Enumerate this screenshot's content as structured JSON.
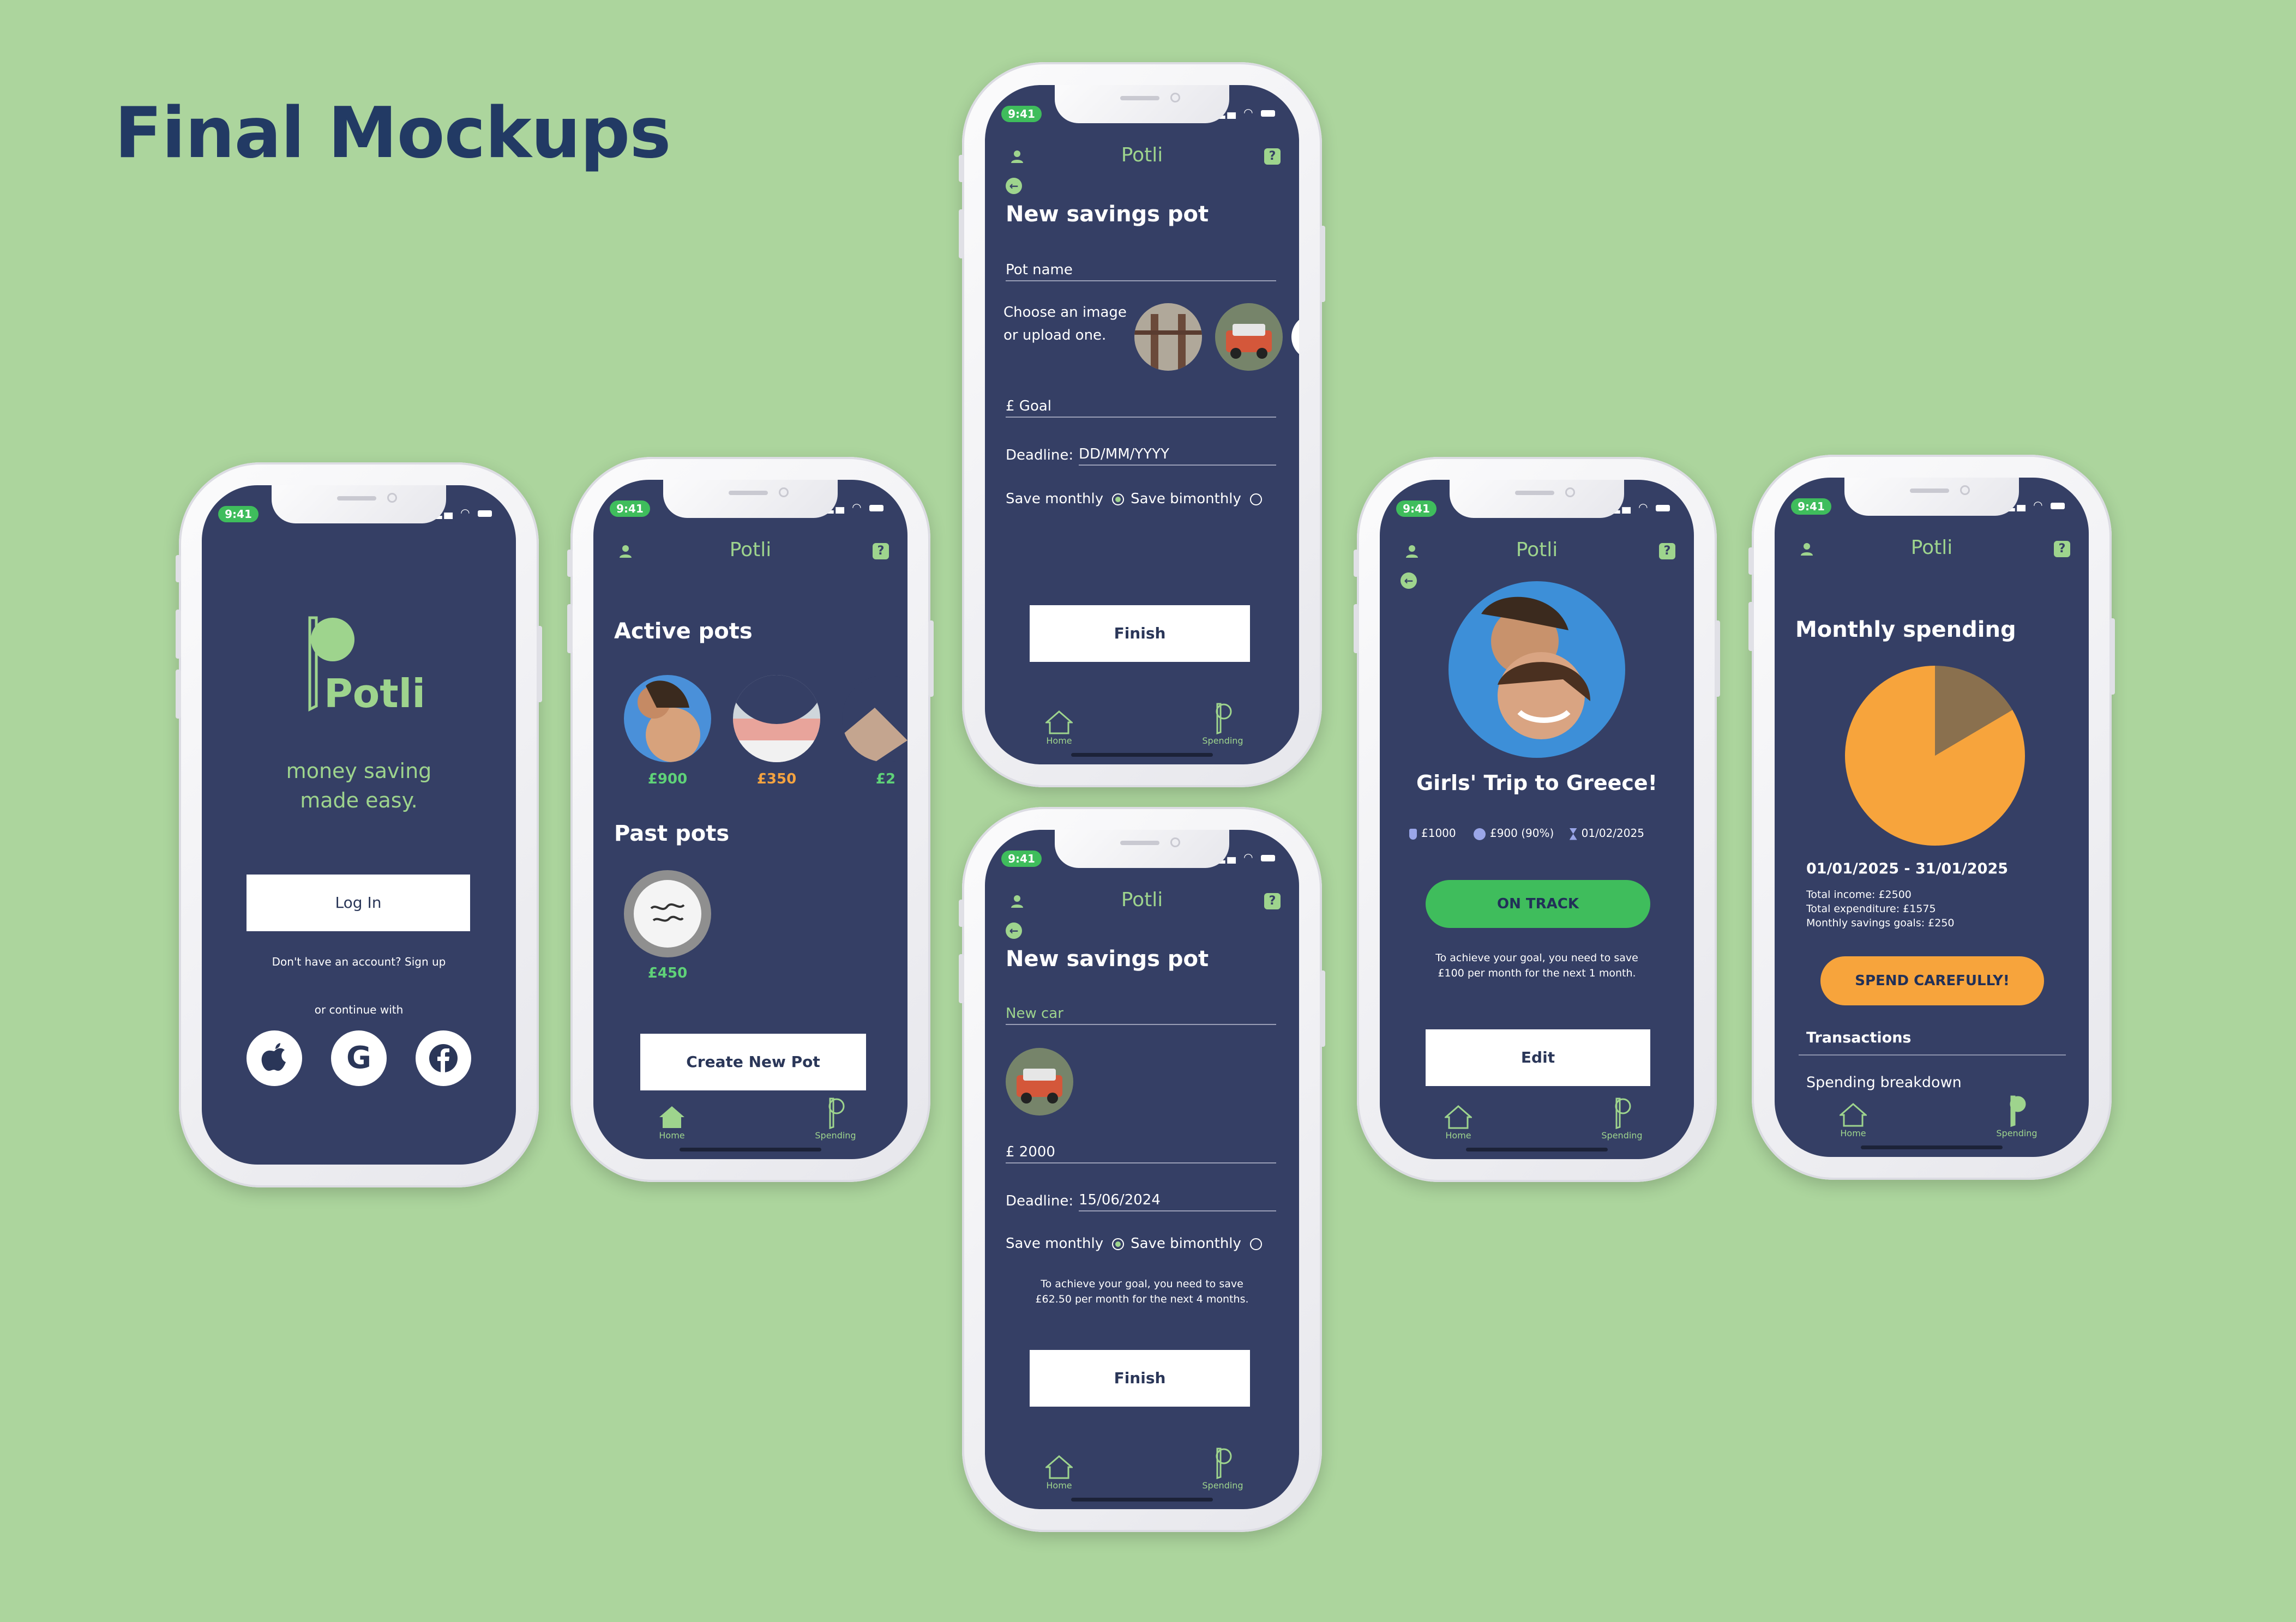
{
  "page": {
    "heading": "Final Mockups"
  },
  "status": {
    "time": "9:41"
  },
  "common": {
    "app_name": "Potli",
    "help_glyph": "?",
    "back_glyph": "←",
    "nav_home": "Home",
    "nav_spending": "Spending"
  },
  "login": {
    "logo_text": "Potli",
    "tagline_line1": "money saving",
    "tagline_line2": "made easy.",
    "login_button": "Log In",
    "signup_prompt": "Don't have an account? Sign up",
    "continue_with": "or continue with",
    "social": [
      "apple-icon",
      "google-icon",
      "facebook-icon"
    ]
  },
  "pots": {
    "active_title": "Active pots",
    "active_pots": [
      {
        "amount": "£900",
        "color": "#5fd278"
      },
      {
        "amount": "£350",
        "color": "#f4a340"
      },
      {
        "amount": "£2",
        "color": "#5fd278"
      }
    ],
    "past_title": "Past pots",
    "past_pots": [
      {
        "amount": "£450",
        "color": "#5fd278"
      }
    ],
    "create_button": "Create New Pot"
  },
  "new_pot_empty": {
    "title": "New savings pot",
    "pot_name_placeholder": "Pot name",
    "choose_image_line1": "Choose an  image",
    "choose_image_line2": "or upload one.",
    "goal_placeholder": "£ Goal",
    "deadline_label": "Deadline:",
    "deadline_placeholder": "DD/MM/YYYY",
    "save_monthly": "Save monthly",
    "save_bimonthly": "Save bimonthly",
    "finish": "Finish"
  },
  "new_pot_filled": {
    "title": "New savings pot",
    "pot_name_value": "New car",
    "goal_value": "£ 2000",
    "deadline_label": "Deadline:",
    "deadline_value": "15/06/2024",
    "save_monthly": "Save monthly",
    "save_bimonthly": "Save bimonthly",
    "advice_line1": "To achieve your goal, you need to save",
    "advice_line2": "£62.50 per month for the next 4 months.",
    "finish": "Finish"
  },
  "pot_detail": {
    "title": "Girls' Trip to Greece!",
    "goal": "£1000",
    "saved": "£900 (90%)",
    "deadline": "01/02/2025",
    "status_button": "ON TRACK",
    "advice_line1": "To achieve your goal, you need to save",
    "advice_line2": "£100 per month for the next 1 month.",
    "edit_button": "Edit"
  },
  "spending": {
    "title": "Monthly spending",
    "period": "01/01/2025 - 31/01/2025",
    "total_income": "Total income: £2500",
    "total_expenditure": "Total expenditure: £1575",
    "savings_goals": "Monthly savings goals: £250",
    "warning_button": "SPEND CAREFULLY!",
    "transactions": "Transactions",
    "breakdown": "Spending breakdown",
    "pie_share": 0.835,
    "pie_colors": {
      "primary": "#f7a43c",
      "secondary": "#8a704e"
    }
  }
}
